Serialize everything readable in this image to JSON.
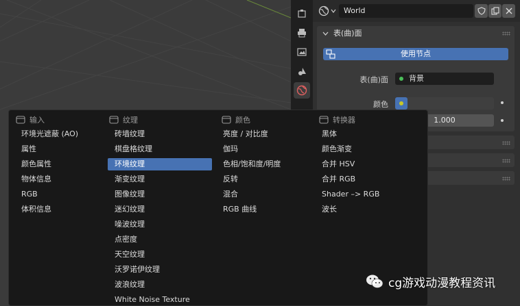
{
  "header": {
    "world_name": "World"
  },
  "surface_panel": {
    "title": "表(曲)面",
    "use_nodes_label": "使用节点",
    "surface_label": "表(曲)面",
    "surface_value": "背景",
    "color_label": "颜色",
    "strength_value": "1.000"
  },
  "menu": {
    "columns": [
      {
        "title": "输入",
        "items": [
          "环境光遮蔽 (AO)",
          "属性",
          "颜色属性",
          "物体信息",
          "RGB",
          "体积信息"
        ]
      },
      {
        "title": "纹理",
        "items": [
          "砖墙纹理",
          "棋盘格纹理",
          "环境纹理",
          "渐变纹理",
          "图像纹理",
          "迷幻纹理",
          "噪波纹理",
          "点密度",
          "天空纹理",
          "沃罗诺伊纹理",
          "波浪纹理",
          "White Noise Texture"
        ]
      },
      {
        "title": "颜色",
        "items": [
          "亮度 / 对比度",
          "伽玛",
          "色相/饱和度/明度",
          "反转",
          "混合",
          "RGB 曲线"
        ]
      },
      {
        "title": "转换器",
        "items": [
          "黑体",
          "颜色渐变",
          "合并 HSV",
          "合并 RGB",
          "Shader –> RGB",
          "波长"
        ]
      }
    ],
    "highlighted_item": "环境纹理"
  },
  "watermark": {
    "text": "cg游戏动漫教程资讯"
  },
  "colors": {
    "accent": "#4772b3",
    "menu_bg": "#181818",
    "panel_bg": "#3a3a3a"
  }
}
